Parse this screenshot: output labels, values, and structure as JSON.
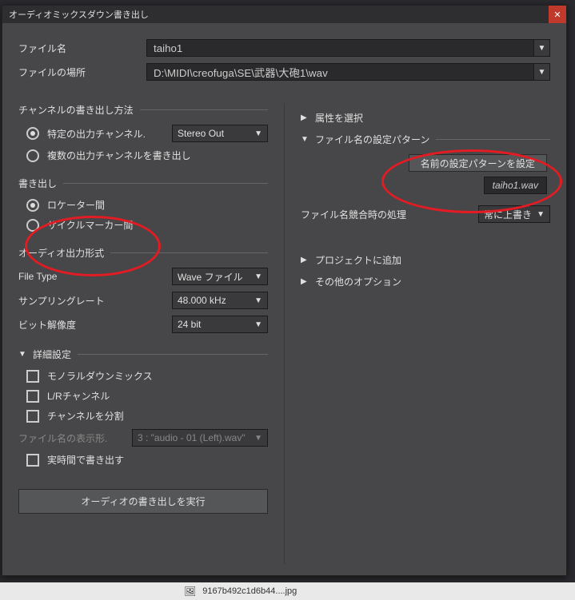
{
  "title": "オーディオミックスダウン書き出し",
  "fields": {
    "name_label": "ファイル名",
    "name_value": "taiho1",
    "path_label": "ファイルの場所",
    "path_value": "D:\\MIDI\\creofuga\\SE\\武器\\大砲1\\wav"
  },
  "channel": {
    "group_title": "チャンネルの書き出し方法",
    "opt_specific": "特定の出力チャンネル.",
    "opt_specific_value": "Stereo Out",
    "opt_multi": "複数の出力チャンネルを書き出し"
  },
  "export": {
    "group_title": "書き出し",
    "opt_locator": "ロケーター間",
    "opt_cycle": "サイクルマーカー間"
  },
  "audio": {
    "group_title": "オーディオ出力形式",
    "file_type_label": "File Type",
    "file_type_value": "Wave ファイル",
    "sample_rate_label": "サンプリングレート",
    "sample_rate_value": "48.000 kHz",
    "bit_depth_label": "ビット解像度",
    "bit_depth_value": "24 bit"
  },
  "advanced": {
    "title": "詳細設定",
    "mono": "モノラルダウンミックス",
    "lr": "L/Rチャンネル",
    "split": "チャンネルを分割",
    "name_fmt_label": "ファイル名の表示形.",
    "name_fmt_value": "3 : \"audio - 01 (Left).wav\"",
    "realtime": "実時間で書き出す"
  },
  "right": {
    "attrib": "属性を選択",
    "pattern_title": "ファイル名の設定パターン",
    "pattern_button": "名前の設定パターンを設定",
    "pattern_preview": "taiho1.wav",
    "conflict_label": "ファイル名競合時の処理",
    "conflict_value": "常に上書き",
    "add_project": "プロジェクトに追加",
    "other": "その他のオプション"
  },
  "exec_button": "オーディオの書き出しを実行",
  "footer_filename": "9167b492c1d6b44....jpg"
}
